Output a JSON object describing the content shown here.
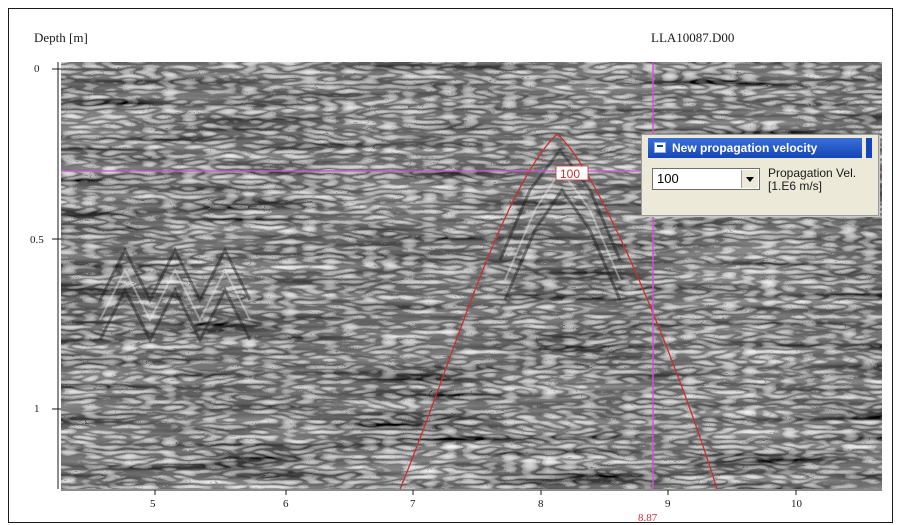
{
  "window": {
    "depth_label": "Depth [m]",
    "file_name": "LLA10087.D00"
  },
  "axes": {
    "y_ticks": [
      "0",
      "0.5",
      "1"
    ],
    "x_ticks": [
      "5",
      "6",
      "7",
      "8",
      "9",
      "10"
    ]
  },
  "cursor": {
    "position_readout": "8.87",
    "hyperbola_velocity_tag": "100"
  },
  "velocity_dialog": {
    "title": "New propagation velocity",
    "selected_value": "100",
    "label_line1": "Propagation Vel.",
    "label_line2": "[1.E6 m/s]"
  },
  "colors": {
    "cursor_line": "#d34fd8",
    "hyperbola": "#c83030",
    "title_bar": "#1546b8",
    "dialog_bg": "#ece9d8"
  },
  "icons": {
    "title_icon": "window-icon",
    "dropdown": "chevron-down-icon"
  }
}
